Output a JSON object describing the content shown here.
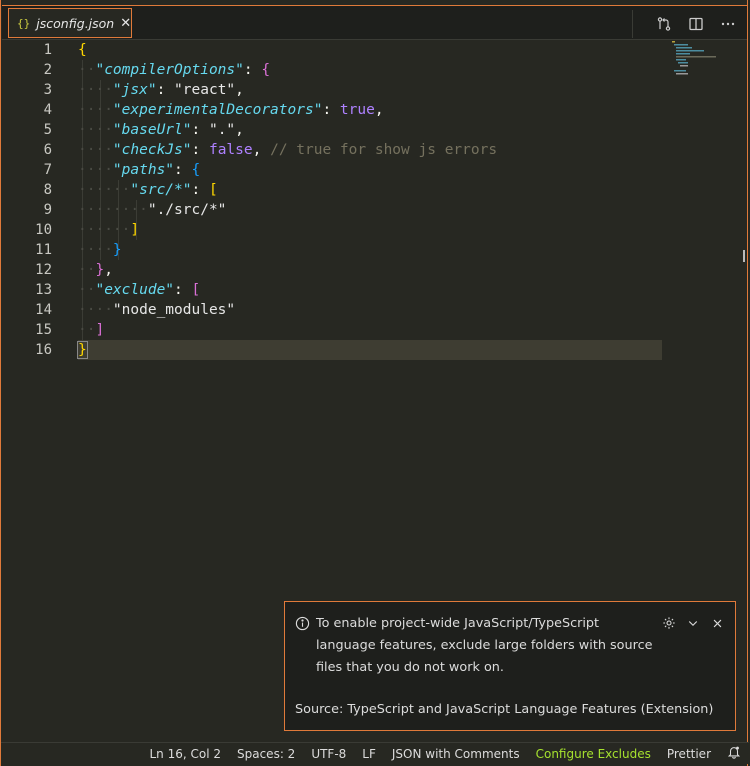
{
  "tab": {
    "icon": "{}",
    "filename": "jsconfig.json",
    "close": "✕"
  },
  "toolbar": {
    "icons": [
      "source-control-compare-icon",
      "split-editor-icon",
      "more-actions-icon"
    ]
  },
  "editor": {
    "line_numbers": [
      "1",
      "2",
      "3",
      "4",
      "5",
      "6",
      "7",
      "8",
      "9",
      "10",
      "11",
      "12",
      "13",
      "14",
      "15",
      "16"
    ],
    "cursor_line": 16
  },
  "notification": {
    "message": "To enable project-wide JavaScript/TypeScript language features, exclude large folders with source files that you do not work on.",
    "source": "Source: TypeScript and JavaScript Language Features (Extension)"
  },
  "status_bar": {
    "position": "Ln 16, Col 2",
    "spaces": "Spaces: 2",
    "encoding": "UTF-8",
    "eol": "LF",
    "language": "JSON with Comments",
    "configure_excludes": "Configure Excludes",
    "formatter": "Prettier"
  },
  "colors": {
    "accent_border": "#e07a3a",
    "editor_bg": "#272822",
    "key": "#66d9ef",
    "comment": "#75715e"
  }
}
